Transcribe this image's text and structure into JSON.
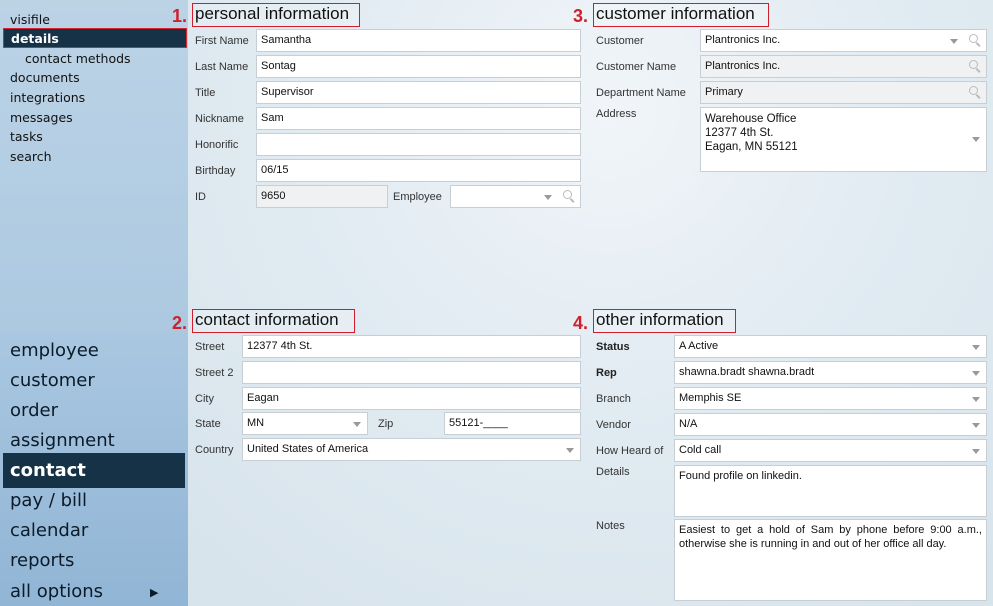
{
  "sidebar": {
    "subnav": [
      "visifile",
      "details",
      "contact methods",
      "documents",
      "integrations",
      "messages",
      "tasks",
      "search"
    ],
    "mainnav": [
      "employee",
      "customer",
      "order",
      "assignment",
      "contact",
      "pay / bill",
      "calendar",
      "reports",
      "all options"
    ],
    "selected_sub": "details",
    "selected_main": "contact"
  },
  "sections": {
    "personal": {
      "num": "1.",
      "title": "personal information"
    },
    "contact": {
      "num": "2.",
      "title": "contact information"
    },
    "customer": {
      "num": "3.",
      "title": "customer information"
    },
    "other": {
      "num": "4.",
      "title": "other information"
    }
  },
  "personal": {
    "first_name_label": "First Name",
    "first_name": "Samantha",
    "last_name_label": "Last Name",
    "last_name": "Sontag",
    "title_label": "Title",
    "title": "Supervisor",
    "nickname_label": "Nickname",
    "nickname": "Sam",
    "honorific_label": "Honorific",
    "honorific": "",
    "birthday_label": "Birthday",
    "birthday": "06/15",
    "id_label": "ID",
    "id": "9650",
    "employee_label": "Employee",
    "employee": ""
  },
  "contact": {
    "street_label": "Street",
    "street": "12377 4th St.",
    "street2_label": "Street 2",
    "street2": "",
    "city_label": "City",
    "city": "Eagan",
    "state_label": "State",
    "state": "MN",
    "zip_label": "Zip",
    "zip": "55121-____",
    "country_label": "Country",
    "country": "United States of America"
  },
  "customer": {
    "customer_label": "Customer",
    "customer": "Plantronics Inc.",
    "customer_name_label": "Customer Name",
    "customer_name": "Plantronics Inc.",
    "department_label": "Department Name",
    "department": "Primary",
    "address_label": "Address",
    "address_lines": [
      "Warehouse Office",
      "12377 4th St.",
      "Eagan, MN 55121"
    ]
  },
  "other": {
    "status_label": "Status",
    "status": "A  Active",
    "rep_label": "Rep",
    "rep": "shawna.bradt  shawna.bradt",
    "branch_label": "Branch",
    "branch": "Memphis SE",
    "vendor_label": "Vendor",
    "vendor": "N/A",
    "heard_label": "How Heard of",
    "heard": "Cold call",
    "details_label": "Details",
    "details": "Found profile on linkedin.",
    "notes_label": "Notes",
    "notes": "Easiest to get a hold of Sam by phone before 9:00 a.m., otherwise she is running in and out of her office all day."
  },
  "colors": {
    "nav_dark": "#163247",
    "annotation_red": "#d01f2a",
    "sidebar_blue": "#9fc0dc"
  },
  "icons": {
    "dropdown": "chevron-down-icon",
    "lookup": "search-icon",
    "expand": "arrow-right-icon"
  }
}
